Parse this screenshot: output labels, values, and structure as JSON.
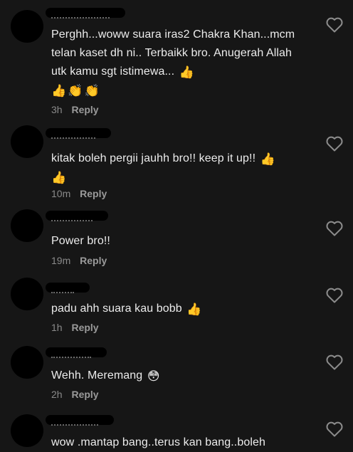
{
  "comments": [
    {
      "text": "Perghh...woww suara iras2 Chakra Khan...mcm telan kaset dh ni.. Terbaikk bro. Anugerah Allah utk kamu sgt istimewa...",
      "emojis": [
        "👍",
        "👍",
        "👏",
        "👏"
      ],
      "time": "3h",
      "reply": "Reply"
    },
    {
      "text": "kitak boleh pergii jauhh bro!! keep it up!!",
      "emojis": [
        "👍",
        "👍"
      ],
      "time": "10m",
      "reply": "Reply"
    },
    {
      "text": "Power bro!!",
      "emojis": [],
      "time": "19m",
      "reply": "Reply"
    },
    {
      "text": "padu ahh suara kau bobb",
      "emojis": [
        "👍"
      ],
      "time": "1h",
      "reply": "Reply"
    },
    {
      "text": "Wehh. Meremang",
      "emojis": [
        "😳"
      ],
      "time": "2h",
      "reply": "Reply"
    },
    {
      "text": "wow .mantap bang..terus kan bang..boleh",
      "emojis": [],
      "time": "",
      "reply": ""
    }
  ],
  "icons": {
    "like": "heart-outline-icon"
  }
}
